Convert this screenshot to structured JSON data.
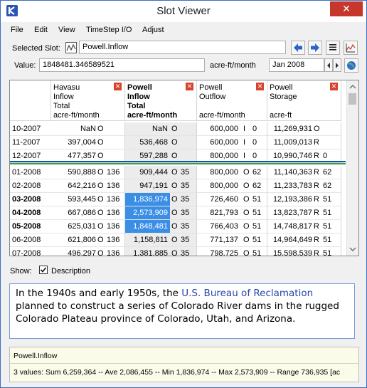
{
  "window": {
    "title": "Slot Viewer",
    "close_glyph": "✕"
  },
  "menu": [
    "File",
    "Edit",
    "View",
    "TimeStep I/O",
    "Adjust"
  ],
  "selected_slot": {
    "label": "Selected Slot:",
    "value": "Powell.Inflow"
  },
  "value_row": {
    "label": "Value:",
    "value": "1848481.346589521",
    "units": "acre-ft/month",
    "date": "Jan 2008"
  },
  "columns": [
    {
      "lines": [
        "Havasu",
        "Inflow",
        "Total",
        "acre-ft/month"
      ],
      "bold": false
    },
    {
      "lines": [
        "Powell",
        "Inflow",
        "Total",
        "acre-ft/month"
      ],
      "bold": true
    },
    {
      "lines": [
        "Powell",
        "Outflow",
        "",
        "acre-ft/month"
      ],
      "bold": false
    },
    {
      "lines": [
        "Powell",
        "Storage",
        "",
        "acre-ft"
      ],
      "bold": false
    }
  ],
  "rows": [
    {
      "date": "10-2007",
      "bold": false,
      "c": [
        [
          "NaN",
          "O",
          ""
        ],
        [
          "NaN",
          "O",
          ""
        ],
        [
          "600,000",
          "I",
          "0"
        ],
        [
          "11,269,931",
          "O",
          ""
        ]
      ]
    },
    {
      "date": "11-2007",
      "bold": false,
      "c": [
        [
          "397,004",
          "O",
          ""
        ],
        [
          "536,468",
          "O",
          ""
        ],
        [
          "600,000",
          "I",
          "0"
        ],
        [
          "11,009,013",
          "R",
          ""
        ]
      ]
    },
    {
      "date": "12-2007",
      "bold": false,
      "c": [
        [
          "477,357",
          "O",
          ""
        ],
        [
          "597,288",
          "O",
          ""
        ],
        [
          "800,000",
          "I",
          "0"
        ],
        [
          "10,990,746",
          "R",
          "0"
        ]
      ]
    },
    {
      "date": "01-2008",
      "bold": false,
      "c": [
        [
          "590,888",
          "O",
          "136"
        ],
        [
          "909,444",
          "O",
          "35"
        ],
        [
          "800,000",
          "O",
          "62"
        ],
        [
          "11,140,363",
          "R",
          "62"
        ]
      ]
    },
    {
      "date": "02-2008",
      "bold": false,
      "c": [
        [
          "642,216",
          "O",
          "136"
        ],
        [
          "947,191",
          "O",
          "35"
        ],
        [
          "800,000",
          "O",
          "62"
        ],
        [
          "11,233,783",
          "R",
          "62"
        ]
      ]
    },
    {
      "date": "03-2008",
      "bold": true,
      "c": [
        [
          "593,445",
          "O",
          "136"
        ],
        [
          "1,836,974",
          "O",
          "35"
        ],
        [
          "726,460",
          "O",
          "51"
        ],
        [
          "12,193,386",
          "R",
          "51"
        ]
      ]
    },
    {
      "date": "04-2008",
      "bold": true,
      "c": [
        [
          "667,086",
          "O",
          "136"
        ],
        [
          "2,573,909",
          "O",
          "35"
        ],
        [
          "821,793",
          "O",
          "51"
        ],
        [
          "13,823,787",
          "R",
          "51"
        ]
      ]
    },
    {
      "date": "05-2008",
      "bold": true,
      "c": [
        [
          "625,031",
          "O",
          "136"
        ],
        [
          "1,848,481",
          "O",
          "35"
        ],
        [
          "766,403",
          "O",
          "51"
        ],
        [
          "14,748,817",
          "R",
          "51"
        ]
      ]
    },
    {
      "date": "06-2008",
      "bold": false,
      "c": [
        [
          "621,806",
          "O",
          "136"
        ],
        [
          "1,158,811",
          "O",
          "35"
        ],
        [
          "771,137",
          "O",
          "51"
        ],
        [
          "14,964,649",
          "R",
          "51"
        ]
      ]
    },
    {
      "date": "07-2008",
      "bold": false,
      "c": [
        [
          "496,297",
          "O",
          "136"
        ],
        [
          "1,381,885",
          "O",
          "35"
        ],
        [
          "798,725",
          "O",
          "51"
        ],
        [
          "15,598,539",
          "R",
          "51"
        ]
      ]
    }
  ],
  "show": {
    "label": "Show:",
    "checkbox_label": "Description",
    "checked": true
  },
  "description": {
    "pre": "In the 1940s and early 1950s, the ",
    "link": "U.S. Bureau of Reclamation",
    "post": " planned to construct a series of Colorado River dams in the rugged Colorado Plateau province of Colorado, Utah, and Arizona."
  },
  "status": {
    "slot": "Powell.Inflow",
    "summary": "3 values:  Sum 6,259,364 -- Ave 2,086,455 -- Min 1,836,974 -- Max 2,573,909 -- Range 736,935 [ac"
  }
}
